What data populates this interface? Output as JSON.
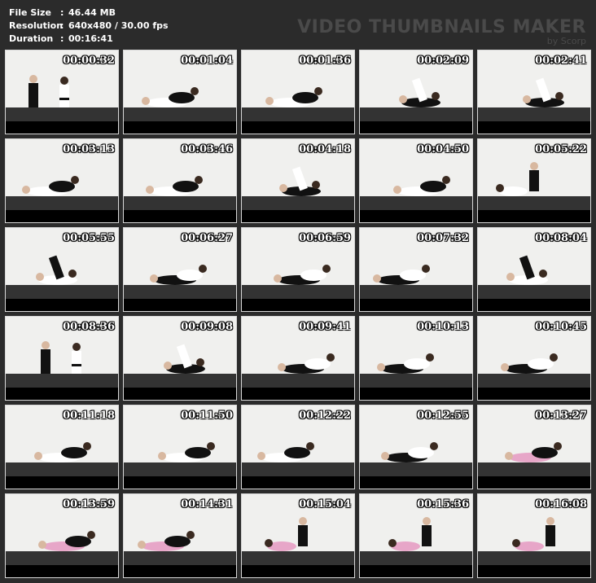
{
  "info": {
    "file_size": {
      "label": "File Size",
      "sep": ":",
      "value": "46.44 MB"
    },
    "resolution": {
      "label": "Resolution",
      "sep": ":",
      "value": "640x480 / 30.00 fps"
    },
    "duration": {
      "label": "Duration",
      "sep": ":",
      "value": "00:16:41"
    }
  },
  "watermark": {
    "title": "VIDEO THUMBNAILS MAKER",
    "subtitle": "by Scorp"
  },
  "colors": {
    "wall": "#f0f0ee",
    "mat": "#333333",
    "gi_white": "#ffffff",
    "gi_black": "#111111",
    "gi_pink": "#e7a6c8"
  },
  "thumbnails": [
    {
      "time": "00:00:32",
      "scene": "kneel"
    },
    {
      "time": "00:01:04",
      "scene": "ground-white"
    },
    {
      "time": "00:01:36",
      "scene": "ground-white"
    },
    {
      "time": "00:02:09",
      "scene": "legs-up-white"
    },
    {
      "time": "00:02:41",
      "scene": "legs-up-white"
    },
    {
      "time": "00:03:13",
      "scene": "ground-white"
    },
    {
      "time": "00:03:46",
      "scene": "ground-white"
    },
    {
      "time": "00:04:18",
      "scene": "legs-up-white"
    },
    {
      "time": "00:04:50",
      "scene": "ground-white"
    },
    {
      "time": "00:05:22",
      "scene": "sit-white"
    },
    {
      "time": "00:05:55",
      "scene": "legs-up-dark"
    },
    {
      "time": "00:06:27",
      "scene": "ground-dark"
    },
    {
      "time": "00:06:59",
      "scene": "ground-dark"
    },
    {
      "time": "00:07:32",
      "scene": "ground-dark"
    },
    {
      "time": "00:08:04",
      "scene": "legs-up-dark"
    },
    {
      "time": "00:08:36",
      "scene": "kneel"
    },
    {
      "time": "00:09:08",
      "scene": "legs-up-white"
    },
    {
      "time": "00:09:41",
      "scene": "ground-dark"
    },
    {
      "time": "00:10:13",
      "scene": "ground-dark"
    },
    {
      "time": "00:10:45",
      "scene": "ground-dark"
    },
    {
      "time": "00:11:18",
      "scene": "ground-white"
    },
    {
      "time": "00:11:50",
      "scene": "ground-white"
    },
    {
      "time": "00:12:22",
      "scene": "ground-white"
    },
    {
      "time": "00:12:55",
      "scene": "ground-dark"
    },
    {
      "time": "00:13:27",
      "scene": "ground-pink"
    },
    {
      "time": "00:13:59",
      "scene": "ground-pink"
    },
    {
      "time": "00:14:31",
      "scene": "ground-pink"
    },
    {
      "time": "00:15:04",
      "scene": "sit-pink"
    },
    {
      "time": "00:15:36",
      "scene": "sit-pink"
    },
    {
      "time": "00:16:08",
      "scene": "sit-pink"
    }
  ]
}
